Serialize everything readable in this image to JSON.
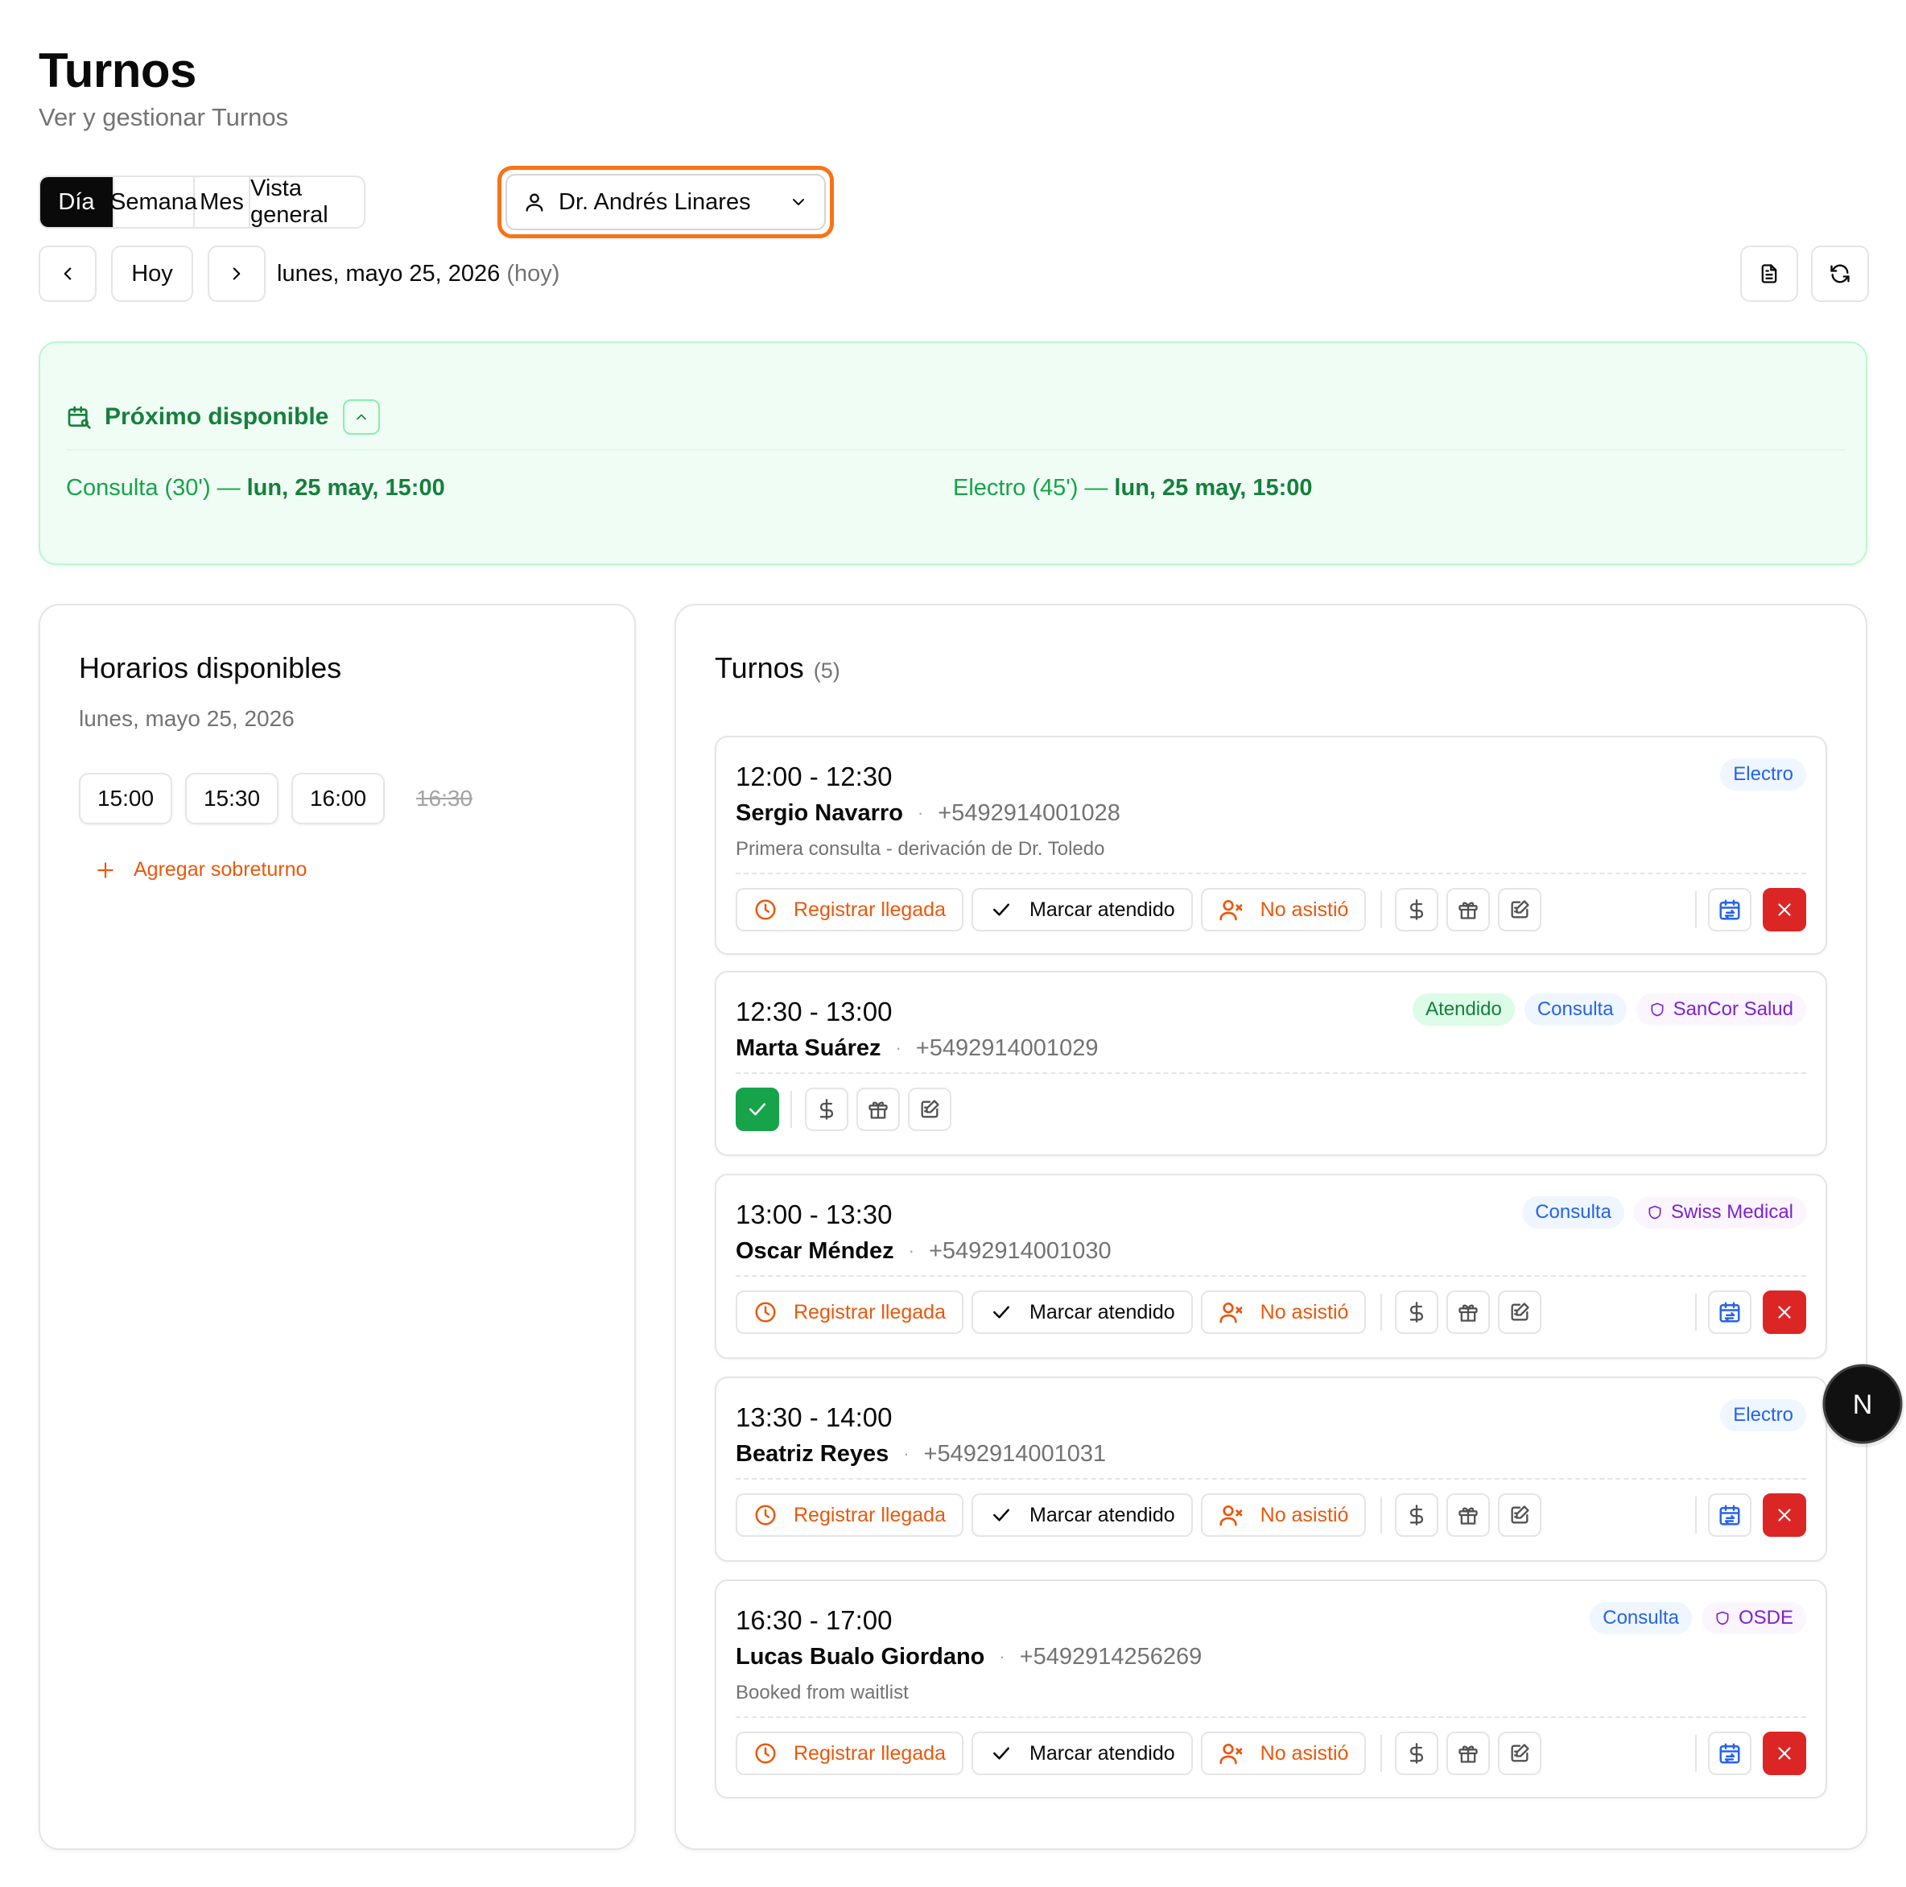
{
  "header": {
    "title": "Turnos",
    "subtitle": "Ver y gestionar Turnos"
  },
  "view_tabs": [
    {
      "label": "Día",
      "active": true
    },
    {
      "label": "Semana",
      "active": false
    },
    {
      "label": "Mes",
      "active": false
    },
    {
      "label": "Vista general",
      "active": false
    }
  ],
  "doctor_select": {
    "value": "Dr. Andrés Linares",
    "icon": "user-icon"
  },
  "date_nav": {
    "prev_icon": "chevron-left-icon",
    "today_label": "Hoy",
    "next_icon": "chevron-right-icon",
    "date": "lunes, mayo 25, 2026",
    "today_marker": "(hoy)",
    "report_icon": "file-text-icon",
    "refresh_icon": "refresh-icon"
  },
  "next_available": {
    "title": "Próximo disponible",
    "items": [
      {
        "service": "Consulta (30')",
        "dash": "—",
        "when": "lun, 25 may, 15:00"
      },
      {
        "service": "Electro (45')",
        "dash": "—",
        "when": "lun, 25 may, 15:00"
      }
    ]
  },
  "slots": {
    "title": "Horarios disponibles",
    "date": "lunes, mayo 25, 2026",
    "items": [
      {
        "time": "15:00",
        "available": true
      },
      {
        "time": "15:30",
        "available": true
      },
      {
        "time": "16:00",
        "available": true
      },
      {
        "time": "16:30",
        "available": false
      }
    ],
    "add_label": "Agregar sobreturno"
  },
  "appointments": {
    "title": "Turnos",
    "count": "(5)",
    "labels": {
      "arrive": "Registrar llegada",
      "attended": "Marcar atendido",
      "no_show": "No asistió"
    },
    "items": [
      {
        "time": "12:00 - 12:30",
        "patient": "Sergio Navarro",
        "sep": "·",
        "phone": "+5492914001028",
        "note": "Primera consulta - derivación de Dr. Toledo",
        "badges": [
          {
            "kind": "type",
            "text": "Electro"
          }
        ],
        "status": "pending"
      },
      {
        "time": "12:30 - 13:00",
        "patient": "Marta Suárez",
        "sep": "·",
        "phone": "+5492914001029",
        "note": "",
        "badges": [
          {
            "kind": "status",
            "text": "Atendido"
          },
          {
            "kind": "type",
            "text": "Consulta"
          },
          {
            "kind": "ins",
            "text": "SanCor Salud"
          }
        ],
        "status": "attended"
      },
      {
        "time": "13:00 - 13:30",
        "patient": "Oscar Méndez",
        "sep": "·",
        "phone": "+5492914001030",
        "note": "",
        "badges": [
          {
            "kind": "type",
            "text": "Consulta"
          },
          {
            "kind": "ins",
            "text": "Swiss Medical"
          }
        ],
        "status": "pending"
      },
      {
        "time": "13:30 - 14:00",
        "patient": "Beatriz Reyes",
        "sep": "·",
        "phone": "+5492914001031",
        "note": "",
        "badges": [
          {
            "kind": "type",
            "text": "Electro"
          }
        ],
        "status": "pending"
      },
      {
        "time": "16:30 - 17:00",
        "patient": "Lucas Bualo Giordano",
        "sep": "·",
        "phone": "+5492914256269",
        "note": "Booked from waitlist",
        "badges": [
          {
            "kind": "type",
            "text": "Consulta"
          },
          {
            "kind": "ins",
            "text": "OSDE"
          }
        ],
        "status": "pending"
      }
    ]
  },
  "floating_badge": {
    "letter": "N"
  },
  "colors": {
    "accent_orange": "#f97316",
    "green": "#15803d",
    "danger": "#dc2626",
    "info": "#2563eb",
    "purple": "#7e22ce"
  }
}
